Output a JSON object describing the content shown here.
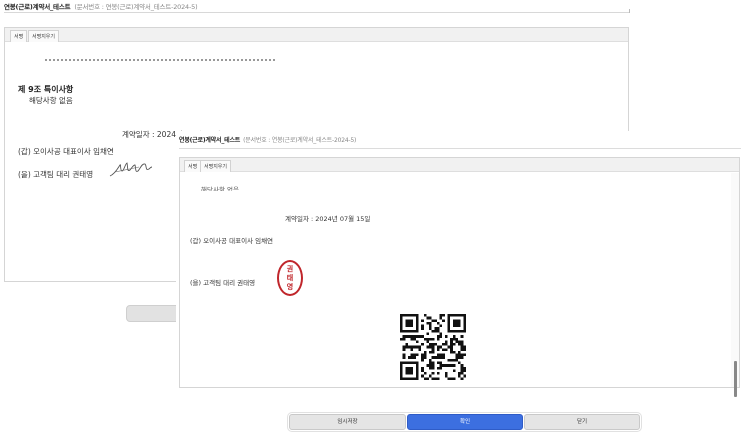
{
  "back_window": {
    "title": "연봉(근로)계약서_테스트",
    "doc_number": "(문서번호 : 연봉(근로)계약서_테스트-2024-5)",
    "tabs": [
      {
        "label": "서명"
      },
      {
        "label": "서명지우기"
      }
    ],
    "section_heading": "제 9조 특이사항",
    "section_body": "해당사항 없음",
    "contract_date": "계약일자 : 2024년 07월 15일",
    "party_a": "(갑)  오이사공   대표이사   임채연",
    "party_b": "(을)  고객팀   대리   권태영"
  },
  "front_window": {
    "title": "연봉(근로)계약서_테스트",
    "doc_number": "(문서번호 : 연봉(근로)계약서_테스트-2024-5)",
    "tabs": [
      {
        "label": "서명"
      },
      {
        "label": "서명지우기"
      }
    ],
    "partial_text": "해당사항 없음",
    "contract_date": "계약일자 : 2024년 07월 15일",
    "party_a": "(갑)  오이사공   대표이사   임채연",
    "party_b": "(을)  고객팀   대리   권태영",
    "stamp": [
      "권",
      "태",
      "영"
    ],
    "qr_icon": "qr-code-icon"
  },
  "buttons": {
    "temp_save": "임시저장",
    "confirm": "확인",
    "close": "닫기"
  },
  "colors": {
    "confirm_button": "#3c6fe0",
    "stamp_red": "#c0262b"
  }
}
